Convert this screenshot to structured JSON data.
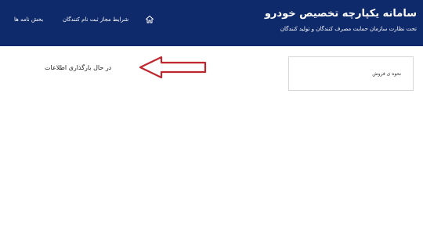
{
  "header": {
    "title": "سامانه یکپارچه تخصیص خودرو",
    "subtitle": "تحت نظارت سازمان حمایت مصرف کنندگان و تولید کنندگان",
    "nav": {
      "registration_label": "شرایط مجاز ثبت نام کنندگان",
      "circulars_label": "بخش نامه ها"
    },
    "icons": {
      "home": "home-icon"
    }
  },
  "sidebar": {
    "sales_method_label": "نحوه ی فروش"
  },
  "main": {
    "loading_text": "در حال بارگذاری اطلاعات"
  },
  "annotation": {
    "arrow_icon": "arrow-left-icon",
    "color": "#c0262d"
  },
  "colors": {
    "header_bg": "#0f2a6b",
    "page_bg": "#ffffff"
  }
}
